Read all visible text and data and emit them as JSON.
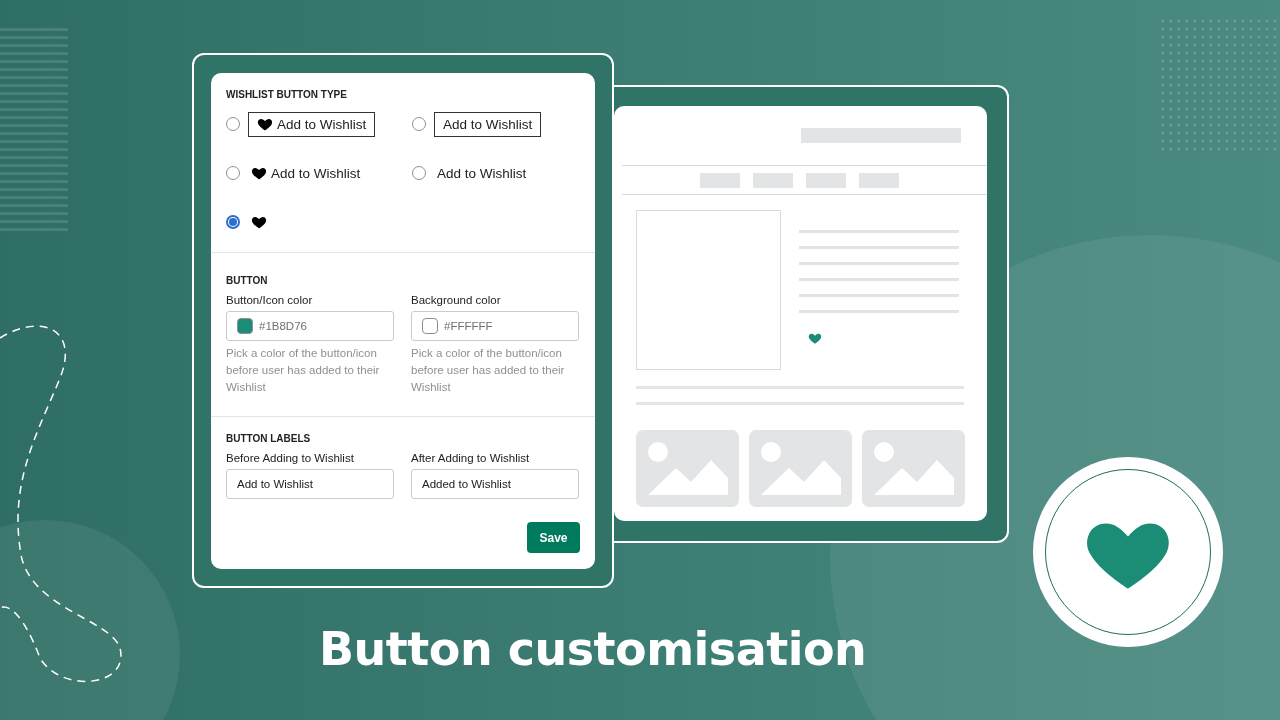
{
  "button_type": {
    "heading": "WISHLIST BUTTON TYPE",
    "options": [
      {
        "kind": "bordered-icon",
        "label": "Add to Wishlist",
        "selected": false
      },
      {
        "kind": "bordered",
        "label": "Add to Wishlist",
        "selected": false
      },
      {
        "kind": "icon-text",
        "label": "Add to Wishlist",
        "selected": false
      },
      {
        "kind": "text",
        "label": "Add to Wishlist",
        "selected": false
      },
      {
        "kind": "icon",
        "selected": true
      }
    ]
  },
  "button_colors": {
    "heading": "BUTTON",
    "fields": [
      {
        "label": "Button/Icon color",
        "value": "#1B8D76",
        "color": "#1b8d76",
        "help": "Pick a color of the button/icon before user has added to their Wishlist"
      },
      {
        "label": "Background color",
        "value": "#FFFFFF",
        "color": "#ffffff",
        "help": "Pick a color of the button/icon before user has added to their Wishlist"
      }
    ]
  },
  "button_labels": {
    "heading": "BUTTON LABELS",
    "fields": [
      {
        "label": "Before Adding to Wishlist",
        "value": "Add to Wishlist"
      },
      {
        "label": "After Adding to Wishlist",
        "value": "Added to Wishlist"
      }
    ]
  },
  "save_button": "Save",
  "caption": "Button customisation"
}
